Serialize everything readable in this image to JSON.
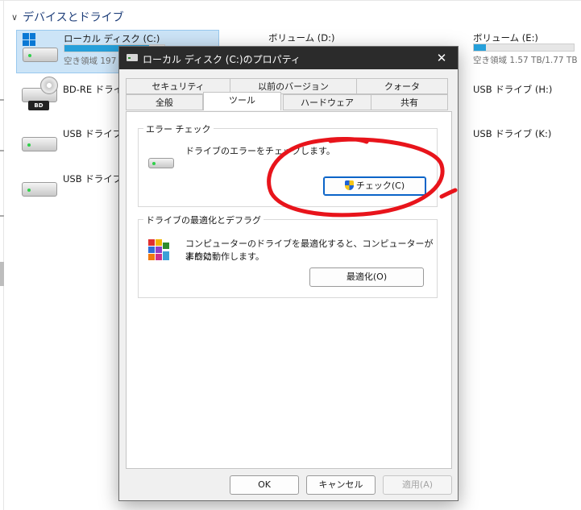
{
  "explorer": {
    "section_header": "デバイスとドライブ",
    "drives": [
      {
        "label": "ローカル ディスク (C:)",
        "free": "空き領域 197",
        "used_fraction": 0.85
      },
      {
        "label": "ボリューム (D:)"
      },
      {
        "label": "ボリューム (E:)",
        "free": "空き領域 1.57 TB/1.77 TB",
        "used_fraction": 0.12
      },
      {
        "label": "BD-RE ドライブ"
      },
      {
        "label": "USB ドライブ (H:)"
      },
      {
        "label": "USB ドライブ ("
      },
      {
        "label": "USB ドライブ (K:)"
      },
      {
        "label": "USB ドライブ ("
      }
    ],
    "bd_badge": "BD",
    "accent_color": "#26a0da",
    "selection_color": "#cce4f7"
  },
  "dialog": {
    "title": "ローカル ディスク (C:)のプロパティ",
    "close_glyph": "✕",
    "tabs_row1": [
      "セキュリティ",
      "以前のバージョン",
      "クォータ"
    ],
    "tabs_row2": [
      "全般",
      "ツール",
      "ハードウェア",
      "共有"
    ],
    "active_tab": "ツール",
    "error_check": {
      "title": "エラー チェック",
      "description": "ドライブのエラーをチェックします。",
      "button": "チェック(C)"
    },
    "optimize": {
      "title": "ドライブの最適化とデフラグ",
      "description_line1": "コンピューターのドライブを最適化すると、コンピューターがより効",
      "description_line2": "率的に動作します。",
      "button": "最適化(O)"
    },
    "footer": {
      "ok": "OK",
      "cancel": "キャンセル",
      "apply": "適用(A)"
    },
    "title_bar_color": "#2b2b2b"
  },
  "annotation": {
    "color": "#e8141b",
    "shape": "hand-drawn circle around check button"
  }
}
